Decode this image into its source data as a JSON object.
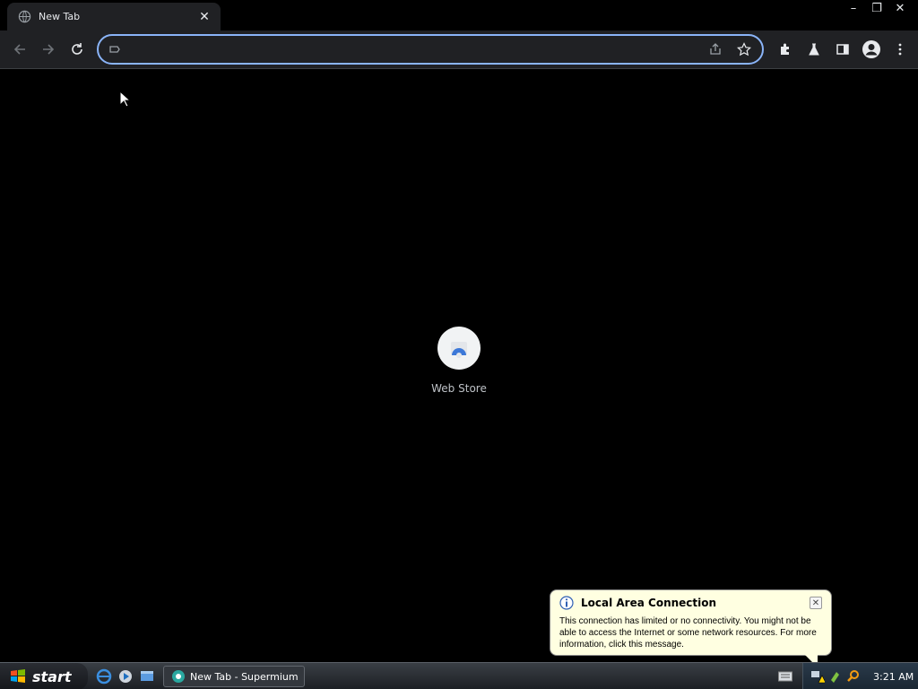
{
  "browser": {
    "tab": {
      "title": "New Tab",
      "favicon": "globe-icon",
      "close": "✕"
    },
    "window_controls": {
      "minimize": "–",
      "restore": "❐",
      "close": "✕"
    },
    "omnibox": {
      "value": "",
      "placeholder": ""
    },
    "toolbar_icons": [
      "back-icon",
      "forward-icon",
      "reload-icon",
      "share-icon",
      "star-icon",
      "extensions-icon",
      "labs-icon",
      "side-panel-icon",
      "profile-icon",
      "menu-icon"
    ]
  },
  "content": {
    "shortcuts": [
      {
        "label": "Web Store",
        "icon": "web-store-icon"
      }
    ]
  },
  "balloon": {
    "title": "Local Area Connection",
    "message": "This connection has limited or no connectivity. You might not be able to access the Internet or some network resources. For more information, click this message.",
    "close": "✕"
  },
  "taskbar": {
    "start_label": "start",
    "task_button_label": "New Tab - Supermium",
    "clock": "3:21 AM"
  },
  "colors": {
    "omnibox_focus": "#8ab4f8",
    "balloon_bg": "#ffffe1",
    "toolbar_bg": "#202124"
  }
}
